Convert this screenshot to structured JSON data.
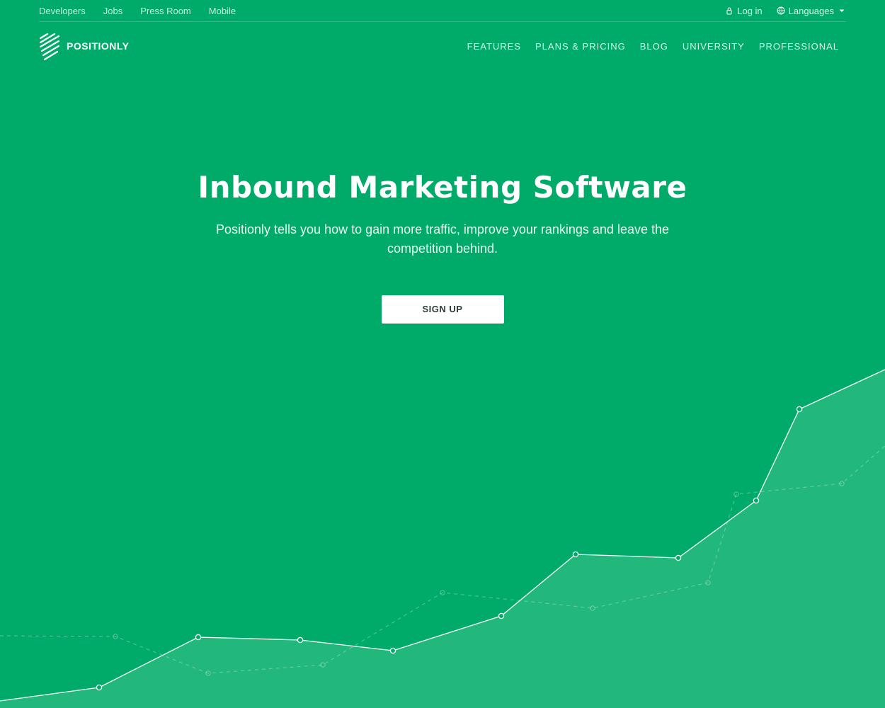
{
  "topbar": {
    "links": [
      "Developers",
      "Jobs",
      "Press Room",
      "Mobile"
    ],
    "login_label": "Log in",
    "languages_label": "Languages"
  },
  "header": {
    "logo_text": "POSITIONLY",
    "nav": [
      "FEATURES",
      "PLANS & PRICING",
      "BLOG",
      "UNIVERSITY",
      "PROFESSIONAL"
    ]
  },
  "hero": {
    "title": "Inbound Marketing Software",
    "subtitle": "Positionly tells you how to gain more traffic, improve your rankings and leave the competition behind.",
    "cta_label": "SIGN UP"
  },
  "colors": {
    "background": "#00ab69",
    "area_fill": "#22b87b",
    "button_text": "#2e3b36"
  },
  "chart_data": {
    "type": "line",
    "decorative": true,
    "series": [
      {
        "values": [
          [
            0,
            10
          ],
          [
            140,
            29
          ],
          [
            280,
            100
          ],
          [
            424,
            96
          ],
          [
            555,
            81
          ],
          [
            708,
            130
          ],
          [
            813,
            217
          ],
          [
            958,
            212
          ],
          [
            1068,
            293
          ],
          [
            1129,
            422
          ],
          [
            1250,
            478
          ]
        ],
        "style": "solid"
      },
      {
        "values": [
          [
            0,
            102
          ],
          [
            163,
            101
          ],
          [
            294,
            49
          ],
          [
            456,
            61
          ],
          [
            625,
            163
          ],
          [
            837,
            141
          ],
          [
            1000,
            177
          ],
          [
            1040,
            302
          ],
          [
            1189,
            317
          ],
          [
            1250,
            370
          ]
        ],
        "style": "dashed"
      }
    ]
  }
}
